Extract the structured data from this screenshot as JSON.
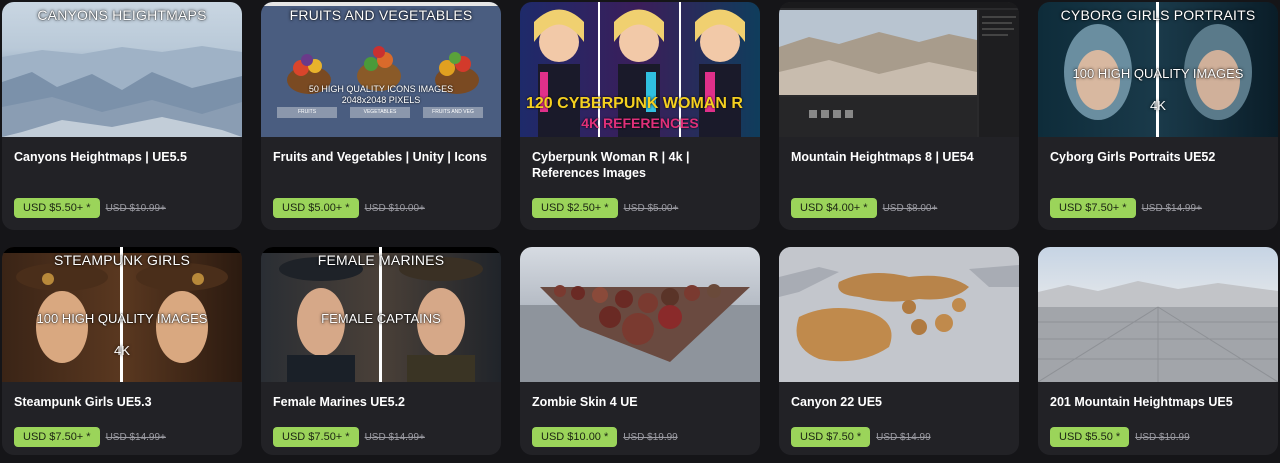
{
  "cards": [
    {
      "overlay_top": "CANYONS HEIGHTMAPS",
      "title": "Canyons Heightmaps | UE5.5",
      "price": "USD $5.50+ *",
      "old_price": "USD $10.99+"
    },
    {
      "overlay_top": "FRUITS AND VEGETABLES",
      "overlay_mid": "50 HIGH QUALITY ICONS IMAGES",
      "overlay_mid2": "2048x2048 PIXELS",
      "buttons": [
        "FRUITS",
        "VEGETABLES",
        "FRUITS AND VEG"
      ],
      "title": "Fruits and Vegetables | Unity | Icons",
      "price": "USD $5.00+ *",
      "old_price": "USD $10.00+"
    },
    {
      "overlay_mid": "120 CYBERPUNK WOMAN R",
      "overlay_low": "4K REFERENCES",
      "title": "Cyberpunk Woman R | 4k | References Images",
      "price": "USD $2.50+ *",
      "old_price": "USD $5.00+"
    },
    {
      "title": "Mountain Heightmaps 8 | UE54",
      "price": "USD $4.00+ *",
      "old_price": "USD $8.00+"
    },
    {
      "overlay_top": "CYBORG GIRLS PORTRAITS",
      "overlay_mid": "100 HIGH QUALITY IMAGES",
      "overlay_low": "4K",
      "title": "Cyborg Girls Portraits UE52",
      "price": "USD $7.50+ *",
      "old_price": "USD $14.99+"
    },
    {
      "overlay_top": "STEAMPUNK GIRLS",
      "overlay_mid": "100 HIGH QUALITY IMAGES",
      "overlay_low": "4K",
      "title": "Steampunk Girls UE5.3",
      "price": "USD $7.50+ *",
      "old_price": "USD $14.99+"
    },
    {
      "overlay_top": "FEMALE MARINES",
      "overlay_mid": "FEMALE CAPTAINS",
      "title": "Female Marines UE5.2",
      "price": "USD $7.50+ *",
      "old_price": "USD $14.99+"
    },
    {
      "title": "Zombie Skin 4 UE",
      "price": "USD $10.00 *",
      "old_price": "USD $19.99"
    },
    {
      "title": "Canyon 22 UE5",
      "price": "USD $7.50 *",
      "old_price": "USD $14.99"
    },
    {
      "title": "201 Mountain Heightmaps UE5",
      "price": "USD $5.50 *",
      "old_price": "USD $10.99"
    }
  ],
  "colors": {
    "background": "#151518",
    "card": "#222226",
    "price_button": "#9bd45a",
    "old_price": "#9b9ba2"
  }
}
